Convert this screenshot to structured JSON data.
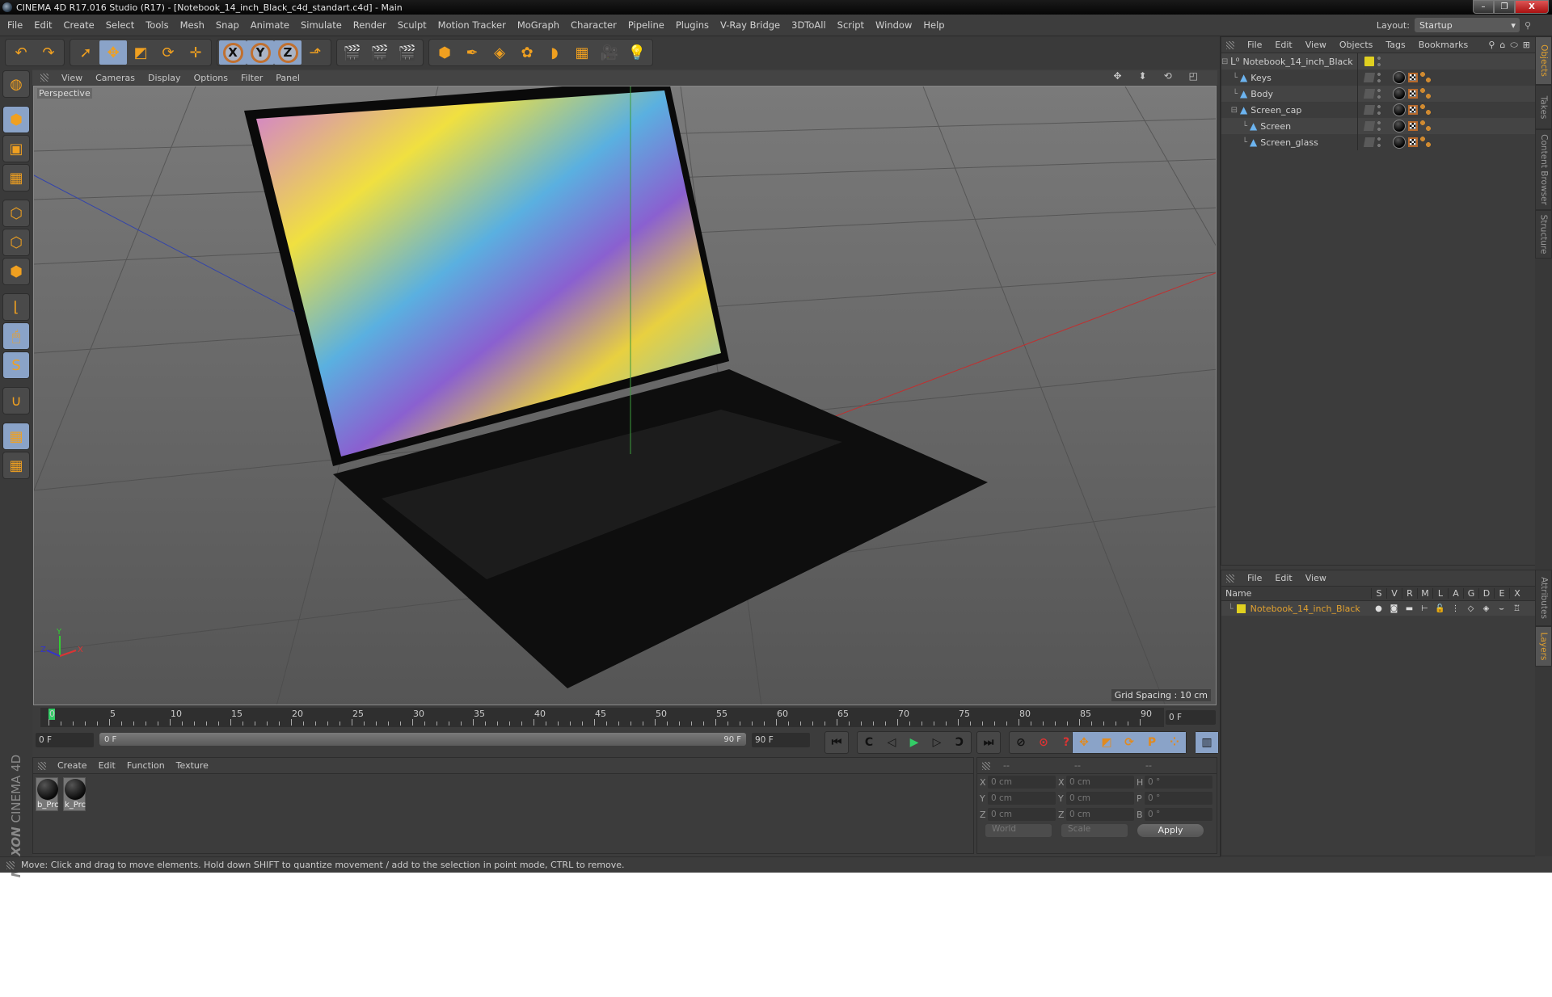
{
  "window": {
    "title": "CINEMA 4D R17.016 Studio (R17) - [Notebook_14_inch_Black_c4d_standart.c4d] - Main",
    "controls": {
      "minimize": "–",
      "maximize": "❐",
      "close": "X"
    }
  },
  "menubar": {
    "items": [
      "File",
      "Edit",
      "Create",
      "Select",
      "Tools",
      "Mesh",
      "Snap",
      "Animate",
      "Simulate",
      "Render",
      "Sculpt",
      "Motion Tracker",
      "MoGraph",
      "Character",
      "Pipeline",
      "Plugins",
      "V-Ray Bridge",
      "3DToAll",
      "Script",
      "Window",
      "Help"
    ],
    "layout_label": "Layout:",
    "layout_value": "Startup"
  },
  "toolbar": {
    "groups": [
      [
        {
          "icon": "undo-icon",
          "glyph": "↶"
        },
        {
          "icon": "redo-icon",
          "glyph": "↷"
        }
      ],
      [
        {
          "icon": "live-selection-icon",
          "glyph": "➚"
        },
        {
          "icon": "move-icon",
          "glyph": "✥",
          "active": true
        },
        {
          "icon": "scale-icon",
          "glyph": "◩"
        },
        {
          "icon": "rotate-icon",
          "glyph": "⟳"
        },
        {
          "icon": "transform-icon",
          "glyph": "✛"
        }
      ],
      [
        {
          "icon": "x-axis-icon",
          "glyph": "X",
          "axis": true
        },
        {
          "icon": "y-axis-icon",
          "glyph": "Y",
          "axis": true
        },
        {
          "icon": "z-axis-icon",
          "glyph": "Z",
          "axis": true
        },
        {
          "icon": "coordinate-system-icon",
          "glyph": "⬏"
        }
      ],
      [
        {
          "icon": "render-view-icon",
          "glyph": "🎬"
        },
        {
          "icon": "render-picture-viewer-icon",
          "glyph": "🎬"
        },
        {
          "icon": "render-settings-icon",
          "glyph": "🎬"
        }
      ],
      [
        {
          "icon": "cube-icon",
          "glyph": "⬢"
        },
        {
          "icon": "pen-spline-icon",
          "glyph": "✒"
        },
        {
          "icon": "subdivision-icon",
          "glyph": "◈"
        },
        {
          "icon": "cloner-icon",
          "glyph": "✿"
        },
        {
          "icon": "deformer-icon",
          "glyph": "◗"
        },
        {
          "icon": "floor-icon",
          "glyph": "▦"
        },
        {
          "icon": "camera-icon",
          "glyph": "🎥"
        },
        {
          "icon": "light-icon",
          "glyph": "💡"
        }
      ]
    ]
  },
  "left_tools": [
    {
      "icon": "make-editable-icon",
      "glyph": "◍"
    },
    {
      "icon": "model-mode-icon",
      "glyph": "⬢",
      "active": true,
      "sep": true
    },
    {
      "icon": "texture-mode-icon",
      "glyph": "▣"
    },
    {
      "icon": "workplane-mode-icon",
      "glyph": "▦"
    },
    {
      "icon": "points-mode-icon",
      "glyph": "⬡",
      "sep": true
    },
    {
      "icon": "edges-mode-icon",
      "glyph": "⬡"
    },
    {
      "icon": "polygons-mode-icon",
      "glyph": "⬢"
    },
    {
      "icon": "axis-mode-icon",
      "glyph": "⌊",
      "sep": true
    },
    {
      "icon": "tweak-mode-icon",
      "glyph": "🖱",
      "active": true
    },
    {
      "icon": "solo-icon",
      "glyph": "S",
      "active": true
    },
    {
      "icon": "snap-icon",
      "glyph": "∪",
      "sep": true
    },
    {
      "icon": "workplane-lock-icon",
      "glyph": "▦",
      "active": true,
      "sep": true
    },
    {
      "icon": "workplane-align-icon",
      "glyph": "▦"
    }
  ],
  "viewport": {
    "menu": [
      "View",
      "Cameras",
      "Display",
      "Options",
      "Filter",
      "Panel"
    ],
    "label": "Perspective",
    "grid_spacing": "Grid Spacing : 10 cm",
    "axis_labels": {
      "x": "X",
      "y": "Y",
      "z": "Z"
    },
    "header_icons": [
      "move-view-icon",
      "zoom-view-icon",
      "rotate-view-icon",
      "maximize-view-icon"
    ]
  },
  "timeline": {
    "ticks": [
      0,
      5,
      10,
      15,
      20,
      25,
      30,
      35,
      40,
      45,
      50,
      55,
      60,
      65,
      70,
      75,
      80,
      85,
      90
    ],
    "current_frame": "0 F",
    "start_field": "0 F",
    "range_start": "0 F",
    "range_end": "90 F",
    "end_field": "90 F",
    "playhead_frame": 0,
    "max_frame": 90
  },
  "playback": {
    "transport": [
      {
        "icon": "go-to-start-icon",
        "glyph": "⏮"
      },
      {
        "icon": "previous-key-icon",
        "glyph": "C"
      },
      {
        "icon": "previous-frame-icon",
        "glyph": "◁"
      },
      {
        "icon": "play-icon",
        "glyph": "▶"
      },
      {
        "icon": "next-frame-icon",
        "glyph": "▷"
      },
      {
        "icon": "next-key-icon",
        "glyph": "Ↄ"
      },
      {
        "icon": "go-to-end-icon",
        "glyph": "⏭"
      }
    ],
    "record": [
      {
        "icon": "record-disabled-icon",
        "glyph": "⊘"
      },
      {
        "icon": "autokey-icon",
        "glyph": "⊙"
      },
      {
        "icon": "keyframe-selection-icon",
        "glyph": "?"
      }
    ],
    "key_modes": [
      {
        "icon": "key-position-icon",
        "glyph": "✥"
      },
      {
        "icon": "key-scale-icon",
        "glyph": "◩"
      },
      {
        "icon": "key-rotation-icon",
        "glyph": "⟳"
      },
      {
        "icon": "key-parameter-icon",
        "glyph": "P"
      },
      {
        "icon": "key-pla-icon",
        "glyph": "⁘"
      }
    ],
    "timeline_button": {
      "icon": "timeline-icon",
      "glyph": "▥"
    }
  },
  "materials": {
    "menu": [
      "Create",
      "Edit",
      "Function",
      "Texture"
    ],
    "items": [
      {
        "name": "b_Prc"
      },
      {
        "name": "k_Prc"
      }
    ]
  },
  "branding": {
    "maxon": "MAXON",
    "product": "CINEMA 4D"
  },
  "coordinates": {
    "header": [
      "--",
      "--",
      "--"
    ],
    "rows": [
      {
        "a1": "X",
        "v1": "0 cm",
        "a2": "X",
        "v2": "0 cm",
        "a3": "H",
        "v3": "0 °"
      },
      {
        "a1": "Y",
        "v1": "0 cm",
        "a2": "Y",
        "v2": "0 cm",
        "a3": "P",
        "v3": "0 °"
      },
      {
        "a1": "Z",
        "v1": "0 cm",
        "a2": "Z",
        "v2": "0 cm",
        "a3": "B",
        "v3": "0 °"
      }
    ],
    "coord_system": "World",
    "mode": "Scale",
    "apply_label": "Apply"
  },
  "status": "Move: Click and drag to move elements. Hold down SHIFT to quantize movement / add to the selection in point mode, CTRL to remove.",
  "object_manager": {
    "menu": [
      "File",
      "Edit",
      "View",
      "Objects",
      "Tags",
      "Bookmarks"
    ],
    "objects": [
      {
        "name": "Notebook_14_inch_Black",
        "level": 0,
        "type": "null",
        "expanded": true,
        "layer_color": "#e0d020",
        "tags": false
      },
      {
        "name": "Keys",
        "level": 1,
        "type": "polygon",
        "tags": true
      },
      {
        "name": "Body",
        "level": 1,
        "type": "polygon",
        "tags": true
      },
      {
        "name": "Screen_cap",
        "level": 1,
        "type": "polygon",
        "expanded": true,
        "tags": true
      },
      {
        "name": "Screen",
        "level": 2,
        "type": "polygon",
        "tags": true
      },
      {
        "name": "Screen_glass",
        "level": 2,
        "type": "polygon",
        "tags": true
      }
    ]
  },
  "layer_manager": {
    "menu": [
      "File",
      "Edit",
      "View"
    ],
    "name_header": "Name",
    "columns": [
      "S",
      "V",
      "R",
      "M",
      "L",
      "A",
      "G",
      "D",
      "E",
      "X"
    ],
    "layers": [
      {
        "name": "Notebook_14_inch_Black",
        "color": "#e0d020"
      }
    ]
  },
  "side_tabs": {
    "top": [
      {
        "label": "Objects",
        "active": true
      },
      {
        "label": "Takes"
      },
      {
        "label": "Content Browser"
      },
      {
        "label": "Structure"
      }
    ],
    "bottom": [
      {
        "label": "Attributes"
      },
      {
        "label": "Layers",
        "active": true
      }
    ]
  },
  "colors": {
    "accent_blue": "#8aa3c8",
    "accent_orange": "#e0a030",
    "layer_yellow": "#e0d020",
    "playhead_green": "#33cc66"
  }
}
